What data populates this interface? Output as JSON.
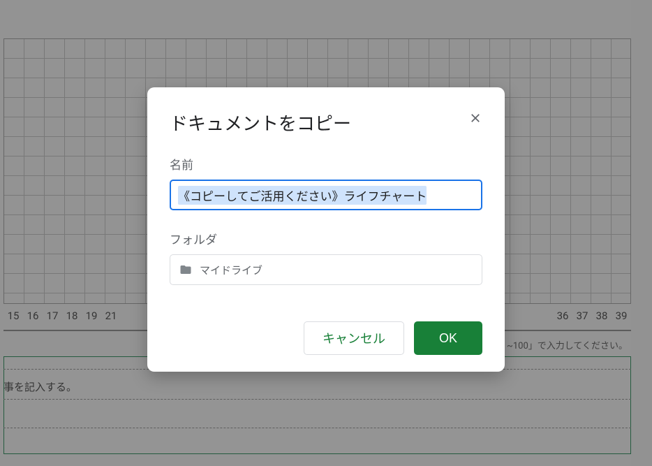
{
  "dialog": {
    "title": "ドキュメントをコピー",
    "name_label": "名前",
    "name_value": "《コピーしてご活用ください》ライフチャート",
    "folder_label": "フォルダ",
    "folder_name": "マイドライブ",
    "cancel_label": "キャンセル",
    "ok_label": "OK"
  },
  "background": {
    "axis_left": [
      "15",
      "16",
      "17",
      "18",
      "19",
      "21"
    ],
    "axis_right": [
      "36",
      "37",
      "38",
      "39"
    ],
    "instruction_right": "~100」で入力してください。",
    "instruction_left": "事を記入する。"
  }
}
